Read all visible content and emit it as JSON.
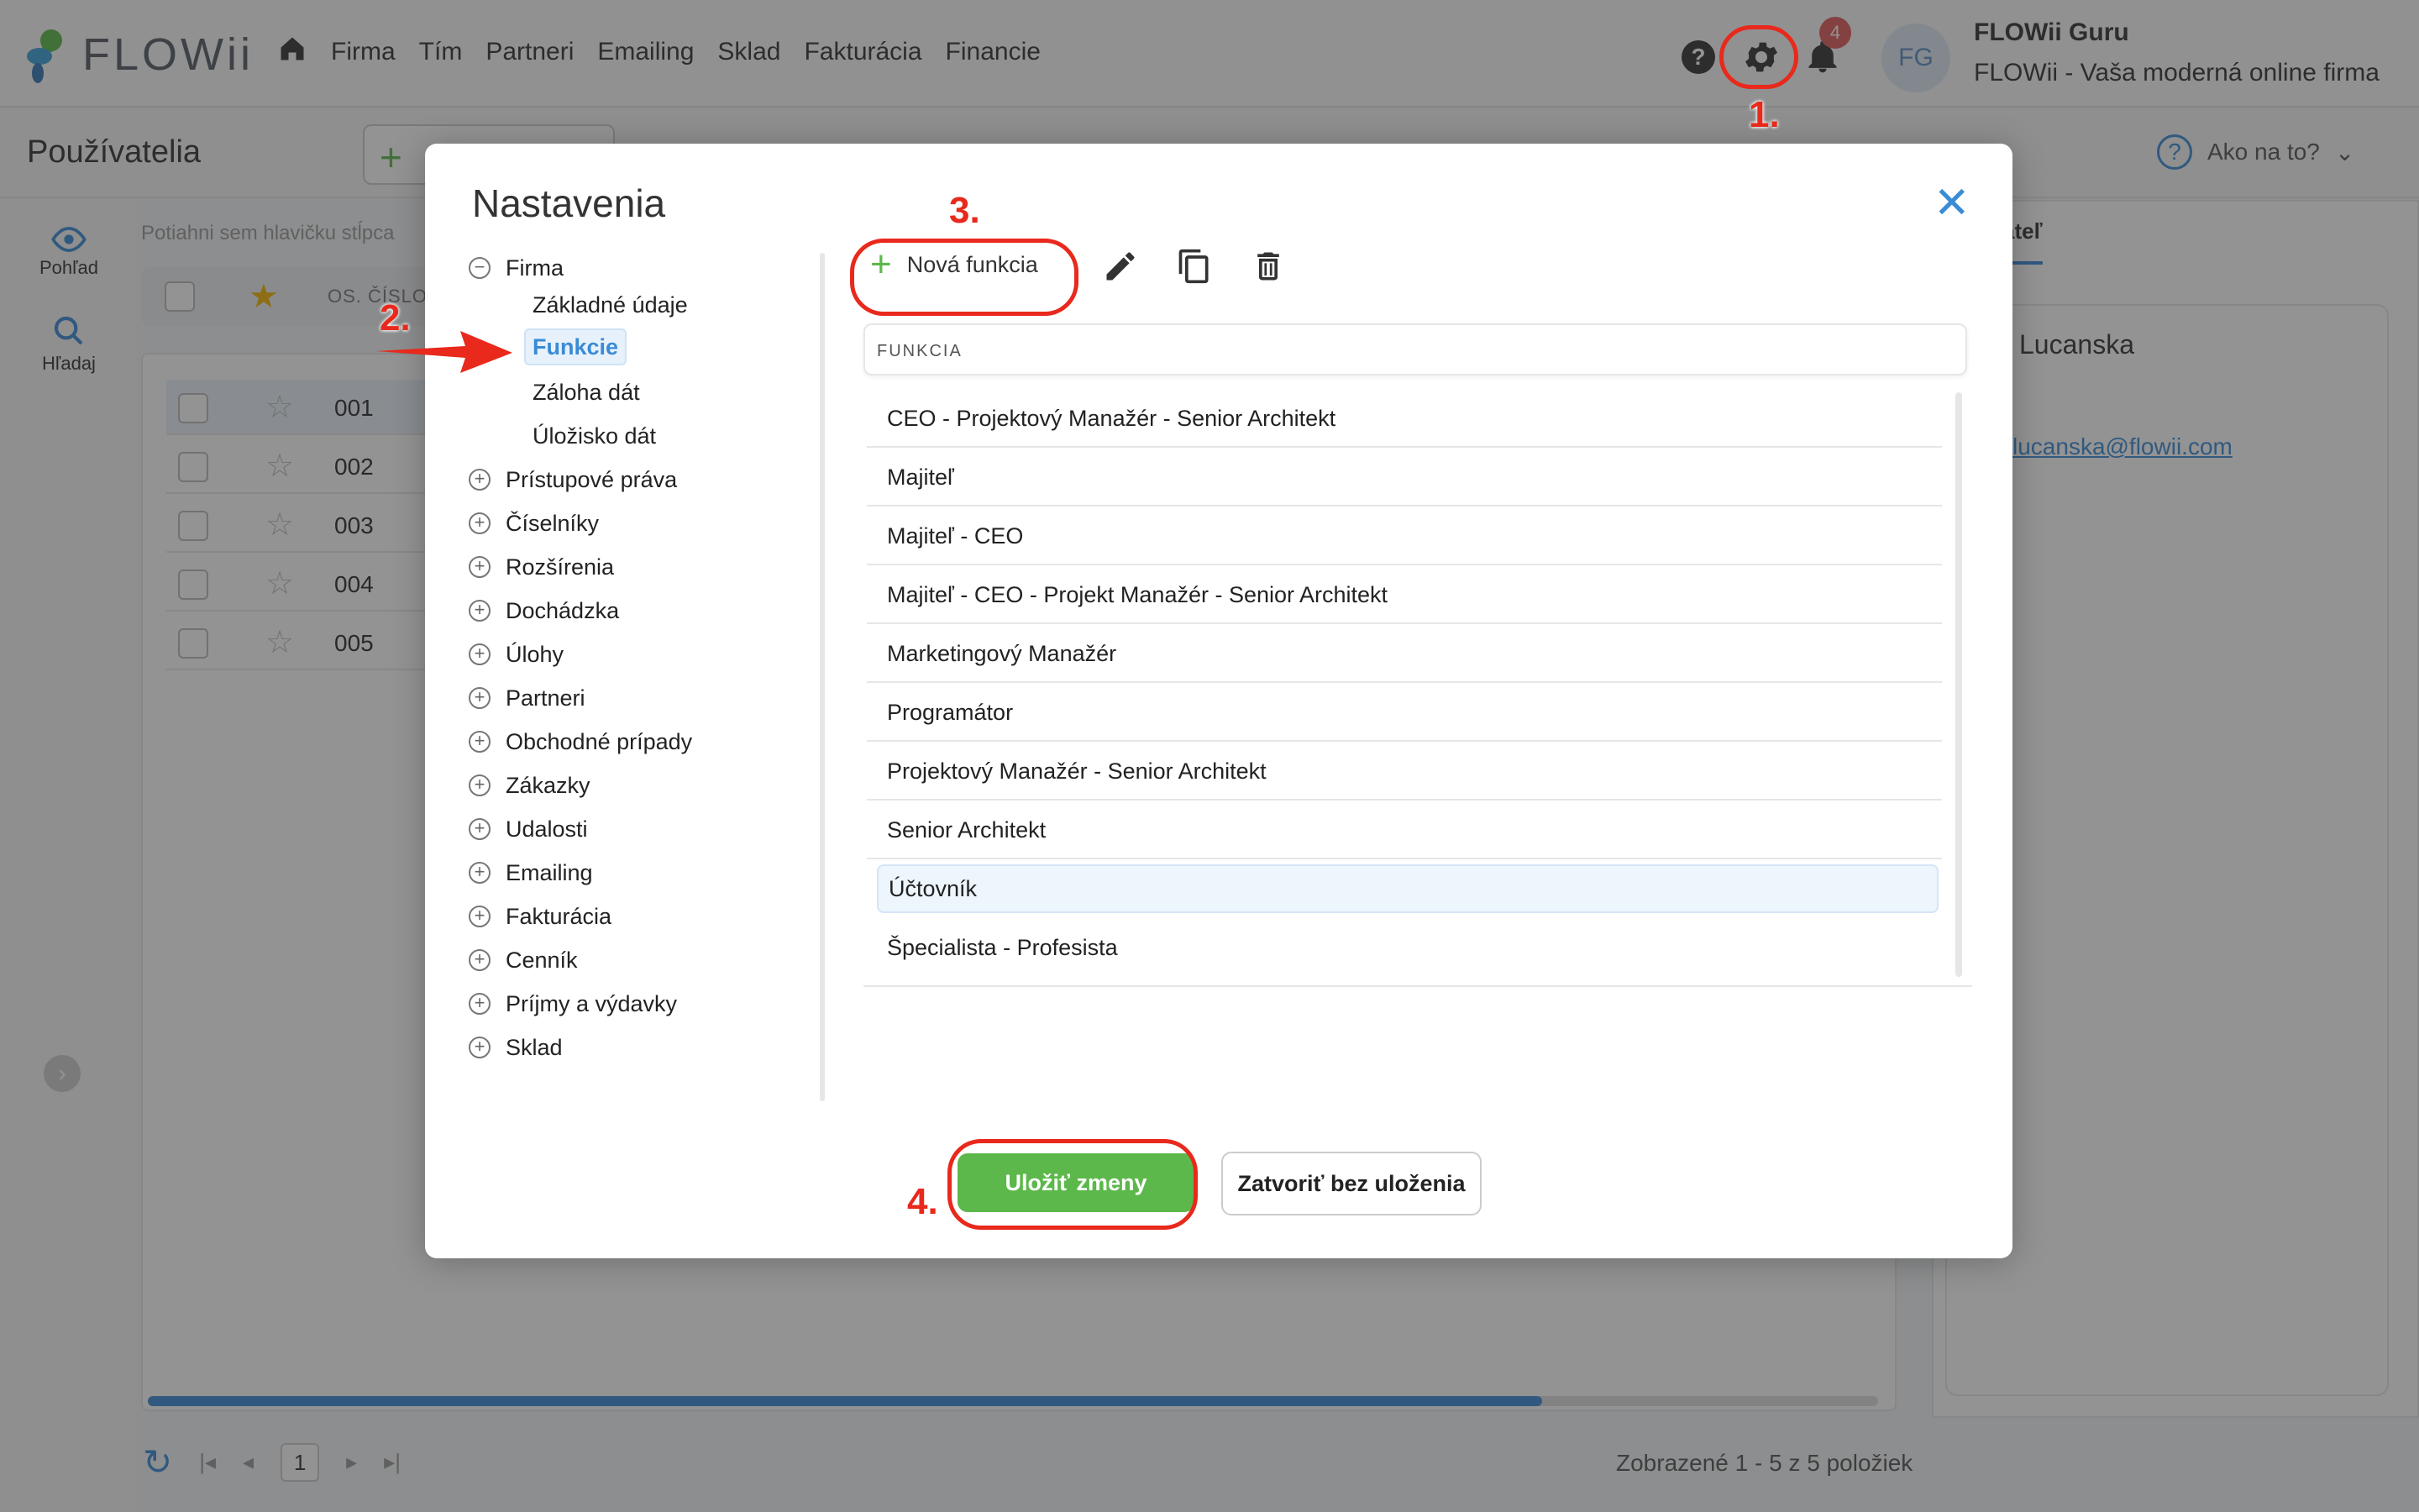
{
  "app": {
    "logo_text": "FLOWii",
    "nav": [
      "Firma",
      "Tím",
      "Partneri",
      "Emailing",
      "Sklad",
      "Fakturácia",
      "Financie"
    ],
    "notification_count": "4",
    "user_initials": "FG",
    "user_name": "FLOWii Guru",
    "user_company": "FLOWii - Vaša moderná online firma",
    "page_title": "Používatelia",
    "how_to": "Ako na to?",
    "rail": {
      "view": "Pohľad",
      "search": "Hľadaj"
    },
    "drag_hint": "Potiahni sem hlavičku stĺpca",
    "column_label": "OS. ČÍSLO",
    "rows": [
      "001",
      "002",
      "003",
      "004",
      "005"
    ],
    "pager_page": "1",
    "pager_info": "Zobrazené 1 - 5 z 5 položiek",
    "right_tab": "ateľ",
    "right_name": "Lucanska",
    "right_email": "lucanska@flowii.com"
  },
  "modal": {
    "title": "Nastavenia",
    "tree": {
      "firma": "Firma",
      "firma_children": [
        "Základné údaje",
        "Funkcie",
        "Záloha dát",
        "Úložisko dát"
      ],
      "sections": [
        "Prístupové práva",
        "Číselníky",
        "Rozšírenia",
        "Dochádzka",
        "Úlohy",
        "Partneri",
        "Obchodné prípady",
        "Zákazky",
        "Udalosti",
        "Emailing",
        "Fakturácia",
        "Cenník",
        "Príjmy a výdavky",
        "Sklad"
      ]
    },
    "new_function_label": "Nová funkcia",
    "list_header": "FUNKCIA",
    "functions": [
      "CEO - Projektový Manažér - Senior Architekt",
      "Majiteľ",
      "Majiteľ - CEO",
      "Majiteľ - CEO - Projekt Manažér - Senior Architekt",
      "Marketingový Manažér",
      "Programátor",
      "Projektový Manažér - Senior Architekt",
      "Senior Architekt",
      "Účtovník",
      "Špecialista - Profesista"
    ],
    "selected_function": "Účtovník",
    "save_label": "Uložiť zmeny",
    "close_label": "Zatvoriť bez uloženia"
  },
  "annotations": {
    "step1": "1.",
    "step2": "2.",
    "step3": "3.",
    "step4": "4."
  },
  "colors": {
    "accent": "#3a8bd6",
    "green": "#5cb84a",
    "annotation_red": "#e8291c"
  }
}
